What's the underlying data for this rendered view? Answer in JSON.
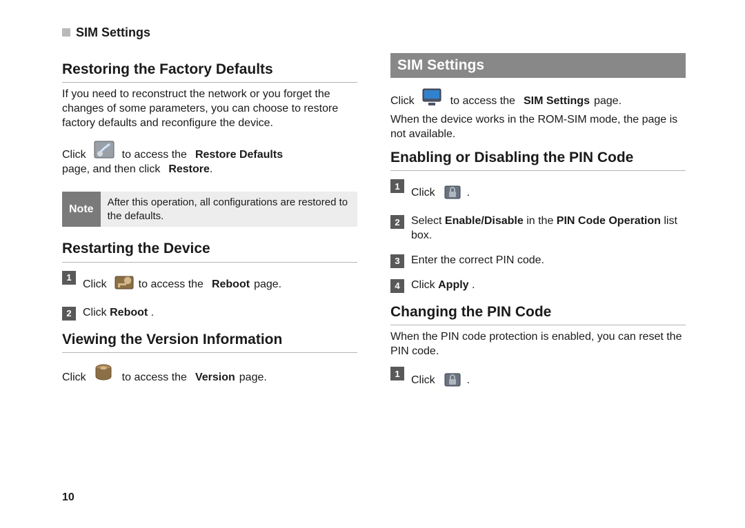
{
  "header": {
    "title": "SIM Settings"
  },
  "left": {
    "restore": {
      "heading": "Restoring the Factory Defaults",
      "intro": "If you need to reconstruct the network or you forget the changes of some parameters, you can choose to restore factory defaults and reconfigure the device.",
      "line_pre": "Click",
      "line_mid": "to access the",
      "line_bold1": "Restore Defaults",
      "line_post1": "page, and then click",
      "line_bold2": "Restore",
      "line_post2": "."
    },
    "note": {
      "label": "Note",
      "text": "After this operation, all configurations are restored to the defaults."
    },
    "restart": {
      "heading": "Restarting the Device",
      "step1_pre": "Click",
      "step1_mid": "to access the",
      "step1_bold": "Reboot",
      "step1_post": "page.",
      "step2_pre": "Click",
      "step2_bold": "Reboot",
      "step2_post": "."
    },
    "version": {
      "heading": "Viewing the Version Information",
      "line_pre": "Click",
      "line_mid": "to access the",
      "line_bold": "Version",
      "line_post": "page."
    }
  },
  "right": {
    "banner": "SIM Settings",
    "intro": {
      "line_pre": "Click",
      "line_mid": "to access the",
      "line_bold": "SIM Settings",
      "line_post": "page.",
      "para2": "When the device works in the ROM-SIM mode, the page is not available."
    },
    "enable": {
      "heading": "Enabling or Disabling the PIN Code",
      "step1_pre": "Click",
      "step1_post": ".",
      "step2_pre": "Select",
      "step2_bold1": "Enable/Disable",
      "step2_mid": "in the",
      "step2_bold2": "PIN Code Operation",
      "step2_post": "list box.",
      "step3": "Enter the correct PIN code.",
      "step4_pre": "Click",
      "step4_bold": "Apply",
      "step4_post": "."
    },
    "change": {
      "heading": "Changing the PIN Code",
      "intro": "When the PIN code protection is enabled, you can reset the PIN code.",
      "step1_pre": "Click",
      "step1_post": "."
    }
  },
  "page_number": "10"
}
